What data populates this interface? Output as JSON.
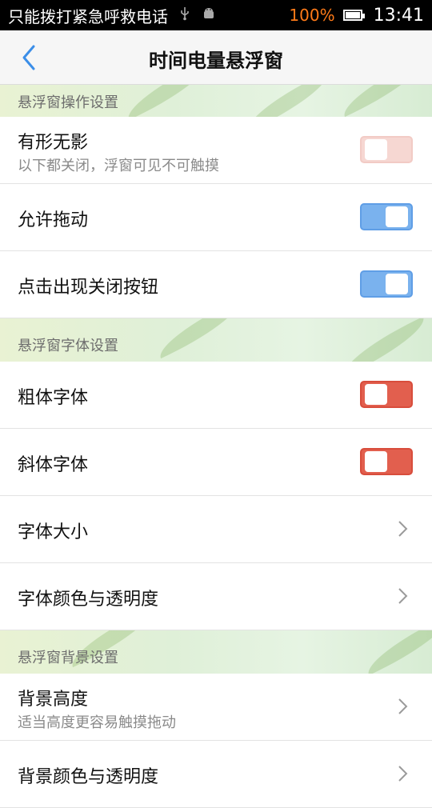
{
  "status_bar": {
    "carrier": "只能拨打紧急呼救电话",
    "battery": "100%",
    "time": "13:41"
  },
  "header": {
    "title": "时间电量悬浮窗"
  },
  "sections": [
    {
      "title": "悬浮窗操作设置",
      "items": [
        {
          "title": "有形无影",
          "subtitle": "以下都关闭，浮窗可见不可触摸",
          "control": "toggle",
          "state": "off"
        },
        {
          "title": "允许拖动",
          "control": "toggle",
          "state": "on"
        },
        {
          "title": "点击出现关闭按钮",
          "control": "toggle",
          "state": "on"
        }
      ]
    },
    {
      "title": "悬浮窗字体设置",
      "items": [
        {
          "title": "粗体字体",
          "control": "toggle",
          "state": "off"
        },
        {
          "title": "斜体字体",
          "control": "toggle",
          "state": "off"
        },
        {
          "title": "字体大小",
          "control": "chevron"
        },
        {
          "title": "字体颜色与透明度",
          "control": "chevron"
        }
      ]
    },
    {
      "title": "悬浮窗背景设置",
      "items": [
        {
          "title": "背景高度",
          "subtitle": "适当高度更容易触摸拖动",
          "control": "chevron"
        },
        {
          "title": "背景颜色与透明度",
          "control": "chevron"
        }
      ]
    }
  ],
  "icons": {
    "back": "chevron-left-icon",
    "usb": "usb-icon",
    "android": "android-icon",
    "battery": "battery-icon",
    "row_chevron": "chevron-right-icon"
  },
  "colors": {
    "accent_blue": "#3b8ee8",
    "toggle_on": "#7ab2ee",
    "toggle_off": "#e25f4e",
    "toggle_off_pale": "#f6d7d2",
    "battery_text": "#ff7a18"
  }
}
